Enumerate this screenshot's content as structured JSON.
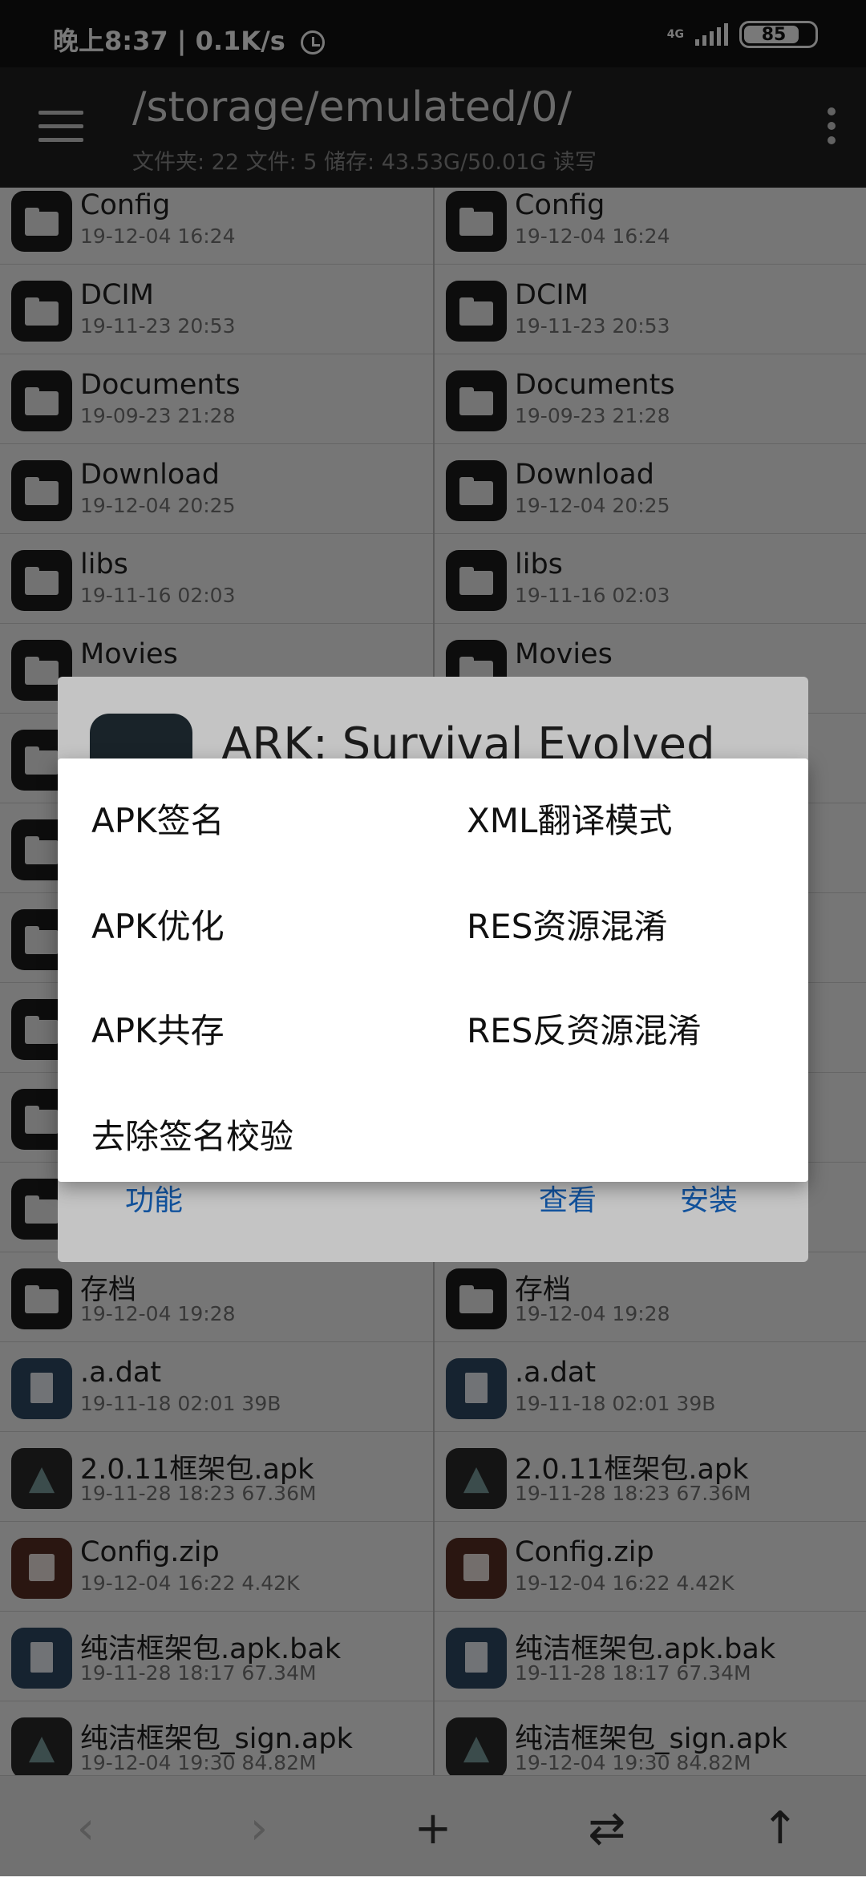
{
  "status_bar": {
    "time": "晚上8:37",
    "speed": "0.1K/s",
    "network": "4G",
    "battery": "85"
  },
  "toolbar": {
    "path": "/storage/emulated/0/",
    "subtitle": "文件夹: 22  文件: 5  储存: 43.53G/50.01G  读写"
  },
  "files": [
    {
      "name": "Config",
      "meta": "19-12-04 16:24",
      "kind": "folder"
    },
    {
      "name": "DCIM",
      "meta": "19-11-23 20:53",
      "kind": "folder"
    },
    {
      "name": "Documents",
      "meta": "19-09-23 21:28",
      "kind": "folder"
    },
    {
      "name": "Download",
      "meta": "19-12-04 20:25",
      "kind": "folder"
    },
    {
      "name": "libs",
      "meta": "19-11-16 02:03",
      "kind": "folder"
    },
    {
      "name": "Movies",
      "meta": "",
      "kind": "folder"
    },
    {
      "name": "",
      "meta": "",
      "kind": "folder"
    },
    {
      "name": "",
      "meta": "",
      "kind": "folder"
    },
    {
      "name": "",
      "meta": "",
      "kind": "folder"
    },
    {
      "name": "",
      "meta": "",
      "kind": "folder"
    },
    {
      "name": "",
      "meta": "",
      "kind": "folder"
    },
    {
      "name": "",
      "meta": "",
      "kind": "folder"
    },
    {
      "name": "存档",
      "meta": "19-12-04 19:28",
      "kind": "folder"
    },
    {
      "name": ".a.dat",
      "meta": "19-11-18 02:01  39B",
      "kind": "file"
    },
    {
      "name": "2.0.11框架包.apk",
      "meta": "19-11-28 18:23  67.36M",
      "kind": "apk"
    },
    {
      "name": "Config.zip",
      "meta": "19-12-04 16:22  4.42K",
      "kind": "zip"
    },
    {
      "name": "纯洁框架包.apk.bak",
      "meta": "19-11-28 18:17  67.34M",
      "kind": "file"
    },
    {
      "name": "纯洁框架包_sign.apk",
      "meta": "19-12-04 19:30  84.82M",
      "kind": "apk"
    }
  ],
  "apk_dialog": {
    "title": "ARK: Survival Evolved",
    "function_label": "功能",
    "view_label": "查看",
    "install_label": "安装"
  },
  "function_menu": {
    "apk_sign": "APK签名",
    "xml_translate": "XML翻译模式",
    "apk_optimize": "APK优化",
    "res_obfuscate": "RES资源混淆",
    "apk_coexist": "APK共存",
    "res_deobfuscate": "RES反资源混淆",
    "remove_sign_check": "去除签名校验"
  },
  "bottom_bar": {
    "back_icon": "‹",
    "forward_icon": "›",
    "add_icon": "+",
    "swap_icon": "⇄",
    "up_icon": "↑"
  }
}
